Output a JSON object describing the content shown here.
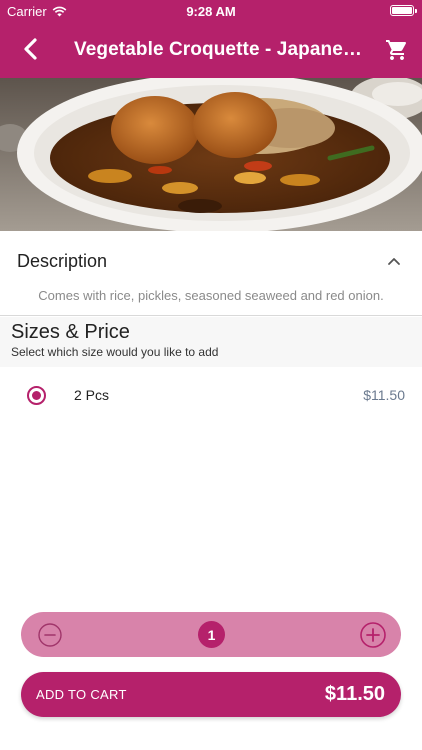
{
  "status_bar": {
    "carrier": "Carrier",
    "time": "9:28 AM"
  },
  "nav": {
    "title": "Vegetable Croquette - Japanese...",
    "back_icon": "chevron-left-icon",
    "cart_icon": "shopping-cart-icon"
  },
  "description": {
    "title": "Description",
    "text": "Comes with rice, pickles, seasoned seaweed and red onion.",
    "expanded": true
  },
  "sizes": {
    "title": "Sizes & Price",
    "subtitle": "Select which size would you like to add",
    "options": [
      {
        "label": "2 Pcs",
        "price": "$11.50",
        "selected": true
      }
    ]
  },
  "quantity": {
    "value": "1"
  },
  "add_to_cart": {
    "label": "ADD TO CART",
    "price": "$11.50"
  },
  "colors": {
    "primary": "#b5216b",
    "stepper_bg": "#d883aa",
    "price_text": "#6b7a8f",
    "muted_text": "#8a8a8a"
  }
}
